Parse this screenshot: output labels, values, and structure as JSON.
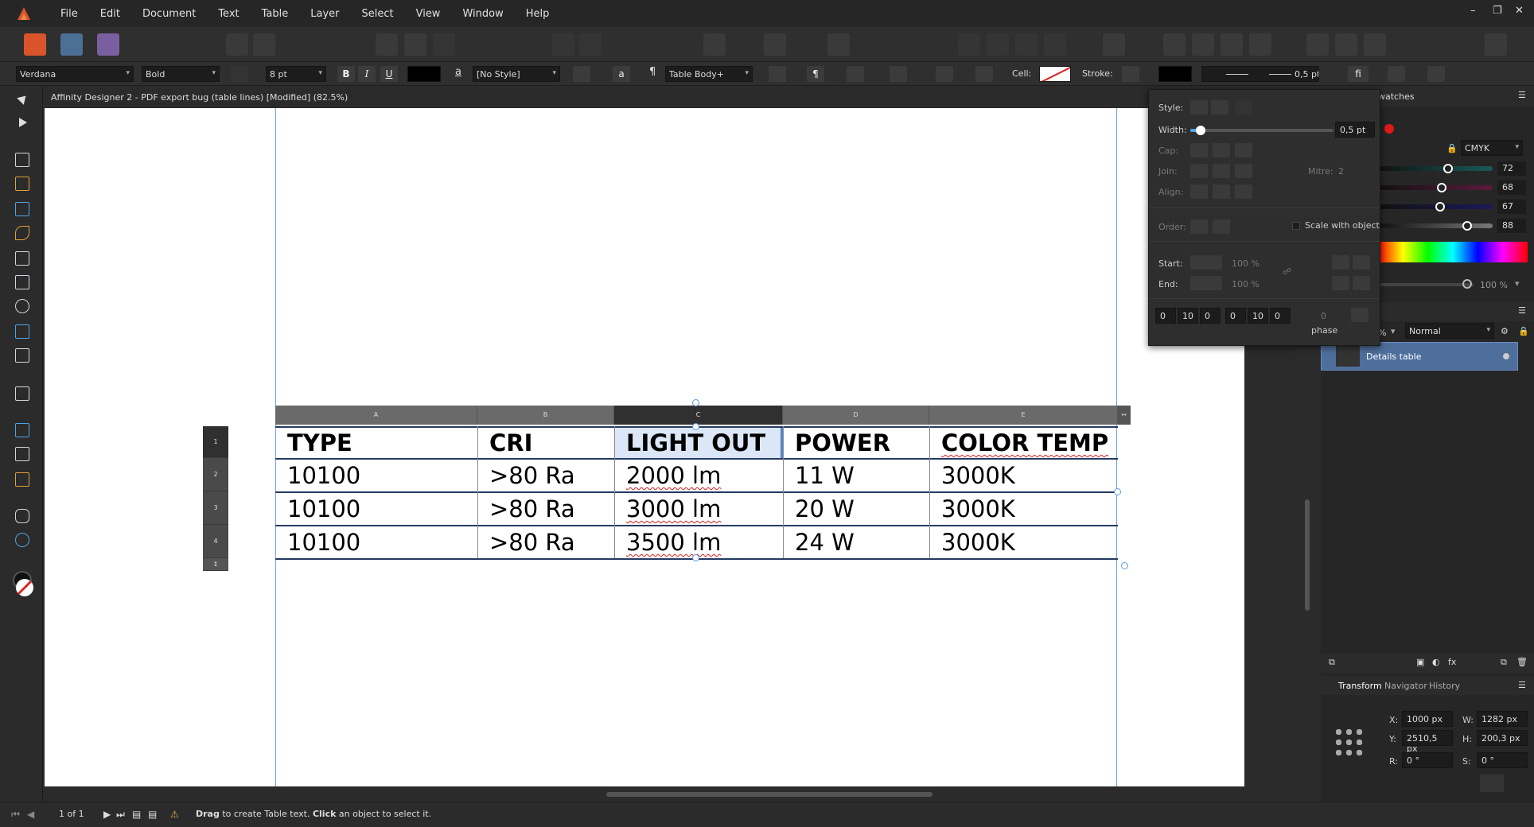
{
  "menu": [
    "File",
    "Edit",
    "Document",
    "Text",
    "Table",
    "Layer",
    "Select",
    "View",
    "Window",
    "Help"
  ],
  "window_controls": {
    "minimize": "–",
    "restore": "❐",
    "close": "✕"
  },
  "context": {
    "font_family": "Verdana",
    "font_weight": "Bold",
    "font_size": "8 pt",
    "bold": "B",
    "italic": "I",
    "underline": "U",
    "char_style": "[No Style]",
    "char_a": "a",
    "para_mark": "¶",
    "para_style": "Table Body+",
    "cell_label": "Cell:",
    "stroke_label": "Stroke:",
    "stroke_width": "0,5 pt",
    "fi": "fi"
  },
  "doc_title": "Affinity Designer 2 - PDF export bug (table lines) [Modified] (82.5%)",
  "table": {
    "columns": [
      "A",
      "B",
      "C",
      "D",
      "E"
    ],
    "rows": [
      "1",
      "2",
      "3",
      "4"
    ],
    "header": [
      "TYPE",
      "CRI",
      "LIGHT OUT",
      "POWER",
      "COLOR TEMP"
    ],
    "body": [
      [
        "10100",
        ">80 Ra",
        "2000 lm",
        "11 W",
        "3000K"
      ],
      [
        "10100",
        ">80 Ra",
        "3000 lm",
        "20 W",
        "3000K"
      ],
      [
        "10100",
        ">80 Ra",
        "3500 lm",
        "24 W",
        "3000K"
      ]
    ]
  },
  "stroke_panel": {
    "style_label": "Style:",
    "width_label": "Width:",
    "width_value": "0,5 pt",
    "width_fraction": 0.05,
    "cap_label": "Cap:",
    "join_label": "Join:",
    "mitre_label": "Mitre:",
    "mitre_value": "2",
    "align_label": "Align:",
    "order_label": "Order:",
    "scale_label": "Scale with object",
    "start_label": "Start:",
    "end_label": "End:",
    "start_pct": "100 %",
    "end_pct": "100 %",
    "dash_values": [
      "0",
      "10",
      "0",
      "0",
      "10",
      "0"
    ],
    "phase_value": "0",
    "phase_label": "phase"
  },
  "swatches": {
    "tab_label": "watches",
    "color_model": "CMYK",
    "c": "72",
    "m": "68",
    "y": "67",
    "k": "88",
    "opacity": "100 %"
  },
  "layers": {
    "blend_mode": "Normal",
    "opacity_suffix": "%",
    "item_label": "Details table"
  },
  "transform": {
    "tabs": [
      "Transform",
      "Navigator",
      "History"
    ],
    "x_label": "X:",
    "x": "1000 px",
    "y_label": "Y:",
    "y": "2510,5 px",
    "w_label": "W:",
    "w": "1282 px",
    "h_label": "H:",
    "h": "200,3 px",
    "r_label": "R:",
    "r": "0 °",
    "s_label": "S:",
    "s": "0 °"
  },
  "status": {
    "page": "1 of 1",
    "hint_bold1": "Drag",
    "hint1": " to create Table text. ",
    "hint_bold2": "Click",
    "hint2": " an object to select it."
  },
  "colors": {
    "accent": "#4ea3e6",
    "table_line": "#243a64",
    "selected_cell": "#dbe7f6",
    "spell_error": "#d42020"
  }
}
